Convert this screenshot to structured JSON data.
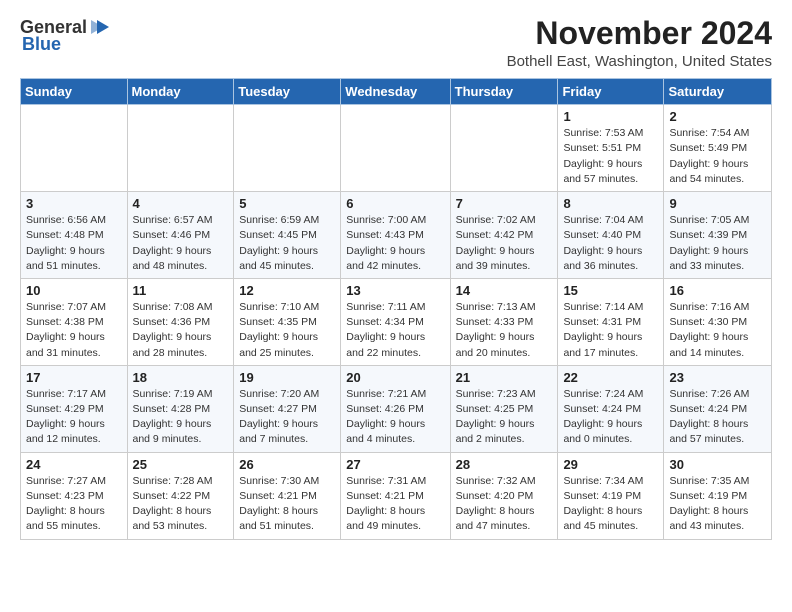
{
  "logo": {
    "line1": "General",
    "line2": "Blue",
    "icon": "▶"
  },
  "title": "November 2024",
  "location": "Bothell East, Washington, United States",
  "weekdays": [
    "Sunday",
    "Monday",
    "Tuesday",
    "Wednesday",
    "Thursday",
    "Friday",
    "Saturday"
  ],
  "weeks": [
    [
      {
        "day": "",
        "info": ""
      },
      {
        "day": "",
        "info": ""
      },
      {
        "day": "",
        "info": ""
      },
      {
        "day": "",
        "info": ""
      },
      {
        "day": "",
        "info": ""
      },
      {
        "day": "1",
        "info": "Sunrise: 7:53 AM\nSunset: 5:51 PM\nDaylight: 9 hours and 57 minutes."
      },
      {
        "day": "2",
        "info": "Sunrise: 7:54 AM\nSunset: 5:49 PM\nDaylight: 9 hours and 54 minutes."
      }
    ],
    [
      {
        "day": "3",
        "info": "Sunrise: 6:56 AM\nSunset: 4:48 PM\nDaylight: 9 hours and 51 minutes."
      },
      {
        "day": "4",
        "info": "Sunrise: 6:57 AM\nSunset: 4:46 PM\nDaylight: 9 hours and 48 minutes."
      },
      {
        "day": "5",
        "info": "Sunrise: 6:59 AM\nSunset: 4:45 PM\nDaylight: 9 hours and 45 minutes."
      },
      {
        "day": "6",
        "info": "Sunrise: 7:00 AM\nSunset: 4:43 PM\nDaylight: 9 hours and 42 minutes."
      },
      {
        "day": "7",
        "info": "Sunrise: 7:02 AM\nSunset: 4:42 PM\nDaylight: 9 hours and 39 minutes."
      },
      {
        "day": "8",
        "info": "Sunrise: 7:04 AM\nSunset: 4:40 PM\nDaylight: 9 hours and 36 minutes."
      },
      {
        "day": "9",
        "info": "Sunrise: 7:05 AM\nSunset: 4:39 PM\nDaylight: 9 hours and 33 minutes."
      }
    ],
    [
      {
        "day": "10",
        "info": "Sunrise: 7:07 AM\nSunset: 4:38 PM\nDaylight: 9 hours and 31 minutes."
      },
      {
        "day": "11",
        "info": "Sunrise: 7:08 AM\nSunset: 4:36 PM\nDaylight: 9 hours and 28 minutes."
      },
      {
        "day": "12",
        "info": "Sunrise: 7:10 AM\nSunset: 4:35 PM\nDaylight: 9 hours and 25 minutes."
      },
      {
        "day": "13",
        "info": "Sunrise: 7:11 AM\nSunset: 4:34 PM\nDaylight: 9 hours and 22 minutes."
      },
      {
        "day": "14",
        "info": "Sunrise: 7:13 AM\nSunset: 4:33 PM\nDaylight: 9 hours and 20 minutes."
      },
      {
        "day": "15",
        "info": "Sunrise: 7:14 AM\nSunset: 4:31 PM\nDaylight: 9 hours and 17 minutes."
      },
      {
        "day": "16",
        "info": "Sunrise: 7:16 AM\nSunset: 4:30 PM\nDaylight: 9 hours and 14 minutes."
      }
    ],
    [
      {
        "day": "17",
        "info": "Sunrise: 7:17 AM\nSunset: 4:29 PM\nDaylight: 9 hours and 12 minutes."
      },
      {
        "day": "18",
        "info": "Sunrise: 7:19 AM\nSunset: 4:28 PM\nDaylight: 9 hours and 9 minutes."
      },
      {
        "day": "19",
        "info": "Sunrise: 7:20 AM\nSunset: 4:27 PM\nDaylight: 9 hours and 7 minutes."
      },
      {
        "day": "20",
        "info": "Sunrise: 7:21 AM\nSunset: 4:26 PM\nDaylight: 9 hours and 4 minutes."
      },
      {
        "day": "21",
        "info": "Sunrise: 7:23 AM\nSunset: 4:25 PM\nDaylight: 9 hours and 2 minutes."
      },
      {
        "day": "22",
        "info": "Sunrise: 7:24 AM\nSunset: 4:24 PM\nDaylight: 9 hours and 0 minutes."
      },
      {
        "day": "23",
        "info": "Sunrise: 7:26 AM\nSunset: 4:24 PM\nDaylight: 8 hours and 57 minutes."
      }
    ],
    [
      {
        "day": "24",
        "info": "Sunrise: 7:27 AM\nSunset: 4:23 PM\nDaylight: 8 hours and 55 minutes."
      },
      {
        "day": "25",
        "info": "Sunrise: 7:28 AM\nSunset: 4:22 PM\nDaylight: 8 hours and 53 minutes."
      },
      {
        "day": "26",
        "info": "Sunrise: 7:30 AM\nSunset: 4:21 PM\nDaylight: 8 hours and 51 minutes."
      },
      {
        "day": "27",
        "info": "Sunrise: 7:31 AM\nSunset: 4:21 PM\nDaylight: 8 hours and 49 minutes."
      },
      {
        "day": "28",
        "info": "Sunrise: 7:32 AM\nSunset: 4:20 PM\nDaylight: 8 hours and 47 minutes."
      },
      {
        "day": "29",
        "info": "Sunrise: 7:34 AM\nSunset: 4:19 PM\nDaylight: 8 hours and 45 minutes."
      },
      {
        "day": "30",
        "info": "Sunrise: 7:35 AM\nSunset: 4:19 PM\nDaylight: 8 hours and 43 minutes."
      }
    ]
  ]
}
